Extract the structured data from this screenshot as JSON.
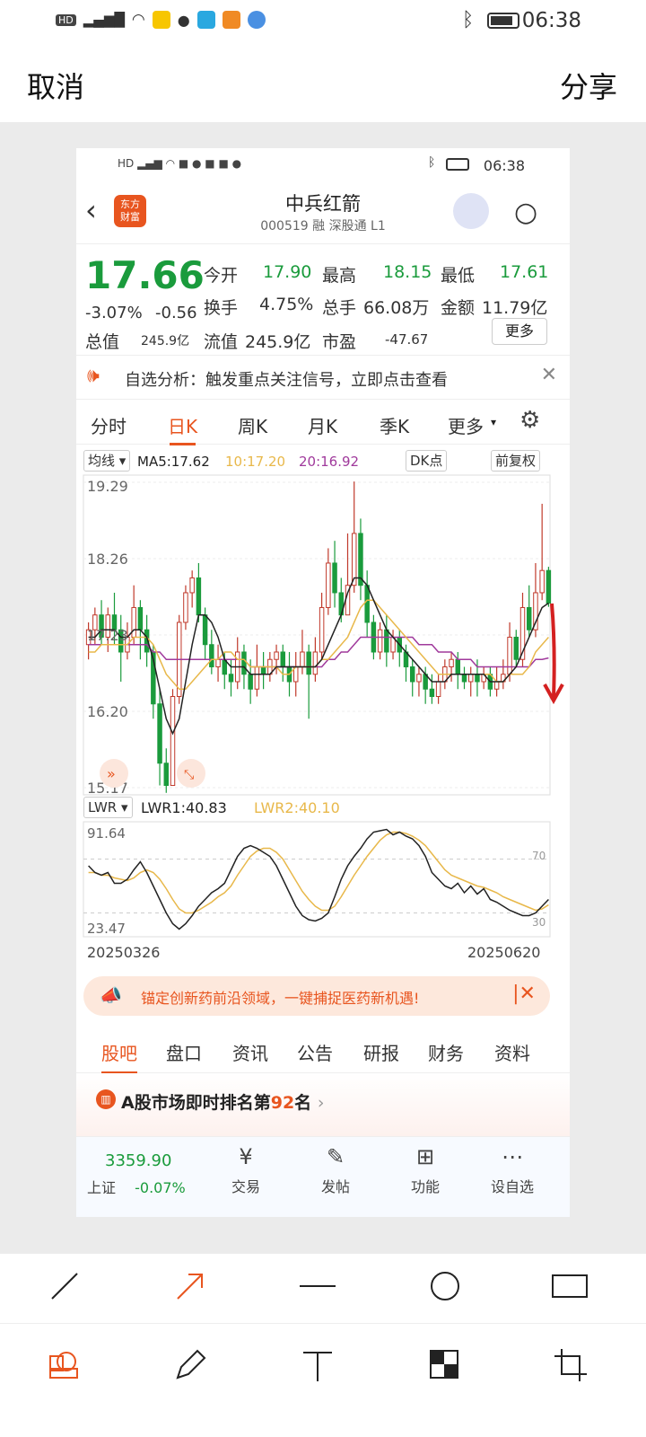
{
  "status": {
    "time": "06:38"
  },
  "header": {
    "cancel": "取消",
    "share": "分享"
  },
  "inner_status": {
    "time": "06:38"
  },
  "stock": {
    "logo_line1": "东方",
    "logo_line2": "财富",
    "name": "中兵红箭",
    "code_line": "000519 融 深股通 L1",
    "price": "17.66",
    "change_pct": "-3.07%",
    "change_abs": "-0.56",
    "open_label": "今开",
    "open": "17.90",
    "high_label": "最高",
    "high": "18.15",
    "low_label": "最低",
    "low": "17.61",
    "turnover_label": "换手",
    "turnover": "4.75%",
    "volume_label": "总手",
    "volume": "66.08万",
    "amount_label": "金额",
    "amount": "11.79亿",
    "mktcap_label": "总值",
    "mktcap": "245.9亿",
    "float_label": "流值",
    "float": "245.9亿",
    "pe_label": "市盈",
    "pe": "-47.67",
    "more": "更多"
  },
  "notice": {
    "text": "自选分析：触发重点关注信号，立即点击查看"
  },
  "ktabs": [
    "分时",
    "日K",
    "周K",
    "月K",
    "季K",
    "更多"
  ],
  "ma": {
    "sel": "均线",
    "ma5": "MA5:17.62",
    "ma10": "10:17.20",
    "ma20": "20:16.92",
    "dk": "DK点",
    "adj": "前复权"
  },
  "chart_data": {
    "type": "candlestick",
    "ylim": [
      15.17,
      19.29
    ],
    "yticks": [
      "19.29",
      "18.26",
      "17.23",
      "16.20",
      "15.17"
    ],
    "colors": {
      "up": "#c0392b",
      "down": "#1a9b3c",
      "ma5": "#222222",
      "ma10": "#e8b84a",
      "ma20": "#a03a9c"
    },
    "candles": [
      [
        17.1,
        17.3,
        17.4,
        16.9
      ],
      [
        17.3,
        17.5,
        17.6,
        17.1
      ],
      [
        17.5,
        17.2,
        17.7,
        17.1
      ],
      [
        17.2,
        17.5,
        17.6,
        17.0
      ],
      [
        17.5,
        17.3,
        17.8,
        17.1
      ],
      [
        17.3,
        17.0,
        17.5,
        16.6
      ],
      [
        17.0,
        17.2,
        17.4,
        16.9
      ],
      [
        17.2,
        17.6,
        17.9,
        17.1
      ],
      [
        17.6,
        17.3,
        17.7,
        16.9
      ],
      [
        17.3,
        17.0,
        17.5,
        16.8
      ],
      [
        17.0,
        16.3,
        17.1,
        16.1
      ],
      [
        16.3,
        15.5,
        16.5,
        15.2
      ],
      [
        15.5,
        15.2,
        15.7,
        15.1
      ],
      [
        15.2,
        16.4,
        16.5,
        15.2
      ],
      [
        16.4,
        17.4,
        17.5,
        16.3
      ],
      [
        17.4,
        17.8,
        17.9,
        17.3
      ],
      [
        17.8,
        18.0,
        18.1,
        17.6
      ],
      [
        18.0,
        17.5,
        18.2,
        17.4
      ],
      [
        17.5,
        17.1,
        17.6,
        16.9
      ],
      [
        17.1,
        16.8,
        17.3,
        16.7
      ],
      [
        16.8,
        16.9,
        17.1,
        16.6
      ],
      [
        16.9,
        16.7,
        17.0,
        16.5
      ],
      [
        16.7,
        16.6,
        16.9,
        16.4
      ],
      [
        16.6,
        17.0,
        17.2,
        16.5
      ],
      [
        17.0,
        16.7,
        17.1,
        16.5
      ],
      [
        16.7,
        16.5,
        16.9,
        16.3
      ],
      [
        16.5,
        16.8,
        17.1,
        16.4
      ],
      [
        16.8,
        16.7,
        17.0,
        16.5
      ],
      [
        16.7,
        16.9,
        17.0,
        16.6
      ],
      [
        16.9,
        17.0,
        17.1,
        16.7
      ],
      [
        17.0,
        16.8,
        17.1,
        16.6
      ],
      [
        16.8,
        16.6,
        17.0,
        16.4
      ],
      [
        16.6,
        16.8,
        17.0,
        16.4
      ],
      [
        16.8,
        17.0,
        17.3,
        16.7
      ],
      [
        17.0,
        16.7,
        17.1,
        16.1
      ],
      [
        16.7,
        17.0,
        17.2,
        16.6
      ],
      [
        17.0,
        17.6,
        17.8,
        16.9
      ],
      [
        17.6,
        18.2,
        18.4,
        17.5
      ],
      [
        18.2,
        17.8,
        18.5,
        17.6
      ],
      [
        17.8,
        17.5,
        18.0,
        17.4
      ],
      [
        17.5,
        17.9,
        18.6,
        17.5
      ],
      [
        17.9,
        18.6,
        19.3,
        17.8
      ],
      [
        18.6,
        17.9,
        18.8,
        17.7
      ],
      [
        17.9,
        17.4,
        18.1,
        17.2
      ],
      [
        17.4,
        17.0,
        17.5,
        16.9
      ],
      [
        17.0,
        17.3,
        17.4,
        16.9
      ],
      [
        17.3,
        17.0,
        17.5,
        16.8
      ],
      [
        17.0,
        17.2,
        17.3,
        16.9
      ],
      [
        17.2,
        17.0,
        17.3,
        16.8
      ],
      [
        17.0,
        16.8,
        17.1,
        16.6
      ],
      [
        16.8,
        16.6,
        16.9,
        16.4
      ],
      [
        16.6,
        16.7,
        16.8,
        16.4
      ],
      [
        16.7,
        16.5,
        16.8,
        16.3
      ],
      [
        16.5,
        16.4,
        16.7,
        16.3
      ],
      [
        16.4,
        16.6,
        16.7,
        16.3
      ],
      [
        16.6,
        16.8,
        16.9,
        16.5
      ],
      [
        16.8,
        16.9,
        17.0,
        16.6
      ],
      [
        16.9,
        16.7,
        17.0,
        16.5
      ],
      [
        16.7,
        16.6,
        16.8,
        16.5
      ],
      [
        16.6,
        16.7,
        16.8,
        16.4
      ],
      [
        16.7,
        16.6,
        16.9,
        16.4
      ],
      [
        16.6,
        16.7,
        16.8,
        16.5
      ],
      [
        16.7,
        16.5,
        16.8,
        16.4
      ],
      [
        16.5,
        16.6,
        16.8,
        16.4
      ],
      [
        16.6,
        16.7,
        16.9,
        16.5
      ],
      [
        16.7,
        17.2,
        17.4,
        16.6
      ],
      [
        17.2,
        16.9,
        17.3,
        16.8
      ],
      [
        16.9,
        17.6,
        17.8,
        16.8
      ],
      [
        17.6,
        17.3,
        17.9,
        17.2
      ],
      [
        17.3,
        17.8,
        18.2,
        17.2
      ],
      [
        17.8,
        18.1,
        19.0,
        17.7
      ],
      [
        18.1,
        17.66,
        18.15,
        17.61
      ]
    ],
    "ma5": [
      17.2,
      17.2,
      17.3,
      17.3,
      17.3,
      17.2,
      17.2,
      17.3,
      17.3,
      17.2,
      16.9,
      16.5,
      16.1,
      15.9,
      16.1,
      16.6,
      17.1,
      17.5,
      17.5,
      17.4,
      17.2,
      16.9,
      16.8,
      16.8,
      16.8,
      16.7,
      16.7,
      16.7,
      16.7,
      16.8,
      16.8,
      16.8,
      16.8,
      16.8,
      16.8,
      16.8,
      16.9,
      17.1,
      17.3,
      17.5,
      17.8,
      18.0,
      18.0,
      17.9,
      17.7,
      17.5,
      17.3,
      17.2,
      17.1,
      17.0,
      16.9,
      16.8,
      16.7,
      16.6,
      16.6,
      16.6,
      16.7,
      16.7,
      16.7,
      16.7,
      16.7,
      16.7,
      16.6,
      16.6,
      16.6,
      16.7,
      16.8,
      17.0,
      17.2,
      17.4,
      17.6,
      17.66
    ],
    "ma10": [
      17.0,
      17.0,
      17.1,
      17.1,
      17.1,
      17.1,
      17.1,
      17.2,
      17.2,
      17.2,
      17.1,
      16.9,
      16.7,
      16.6,
      16.5,
      16.5,
      16.6,
      16.7,
      16.8,
      16.9,
      16.9,
      17.0,
      17.0,
      16.9,
      16.9,
      16.8,
      16.8,
      16.8,
      16.8,
      16.8,
      16.7,
      16.7,
      16.8,
      16.8,
      16.8,
      16.8,
      16.9,
      16.9,
      17.0,
      17.1,
      17.2,
      17.4,
      17.6,
      17.7,
      17.7,
      17.6,
      17.5,
      17.4,
      17.3,
      17.2,
      17.1,
      17.0,
      16.9,
      16.8,
      16.7,
      16.7,
      16.7,
      16.7,
      16.7,
      16.7,
      16.7,
      16.7,
      16.7,
      16.6,
      16.6,
      16.7,
      16.7,
      16.7,
      16.8,
      17.0,
      17.1,
      17.2
    ],
    "ma20": [
      17.1,
      17.1,
      17.1,
      17.1,
      17.1,
      17.1,
      17.1,
      17.1,
      17.1,
      17.1,
      17.0,
      17.0,
      16.9,
      16.9,
      16.9,
      16.9,
      16.9,
      16.9,
      16.9,
      16.9,
      16.9,
      16.9,
      16.9,
      16.9,
      16.9,
      16.8,
      16.8,
      16.8,
      16.8,
      16.8,
      16.8,
      16.8,
      16.8,
      16.8,
      16.8,
      16.8,
      16.8,
      16.9,
      16.9,
      17.0,
      17.0,
      17.1,
      17.2,
      17.2,
      17.2,
      17.2,
      17.2,
      17.2,
      17.2,
      17.2,
      17.2,
      17.1,
      17.1,
      17.1,
      17.0,
      17.0,
      17.0,
      16.9,
      16.9,
      16.9,
      16.8,
      16.8,
      16.8,
      16.8,
      16.8,
      16.8,
      16.8,
      16.8,
      16.8,
      16.9,
      16.9,
      16.92
    ]
  },
  "lwr": {
    "sel": "LWR",
    "lwr1": "LWR1:40.83",
    "lwr2": "LWR2:40.10",
    "ytop": "91.64",
    "ybottom": "23.47",
    "ref70": "70",
    "ref30": "30",
    "ylim": [
      15,
      95
    ],
    "line1": [
      65,
      60,
      58,
      60,
      52,
      52,
      55,
      62,
      68,
      60,
      50,
      40,
      30,
      22,
      18,
      22,
      28,
      35,
      40,
      45,
      48,
      52,
      62,
      72,
      78,
      80,
      78,
      75,
      72,
      65,
      55,
      45,
      35,
      28,
      25,
      24,
      26,
      30,
      42,
      55,
      65,
      72,
      78,
      85,
      90,
      91,
      92,
      88,
      90,
      87,
      85,
      80,
      72,
      60,
      55,
      50,
      48,
      52,
      45,
      50,
      44,
      48,
      40,
      38,
      35,
      32,
      30,
      28,
      28,
      30,
      35,
      40
    ],
    "line2": [
      60,
      60,
      58,
      58,
      56,
      55,
      54,
      56,
      60,
      62,
      60,
      55,
      48,
      40,
      33,
      30,
      30,
      32,
      35,
      38,
      42,
      45,
      50,
      58,
      65,
      72,
      76,
      78,
      78,
      75,
      70,
      62,
      54,
      46,
      40,
      35,
      32,
      32,
      35,
      42,
      50,
      58,
      65,
      72,
      78,
      84,
      88,
      90,
      90,
      89,
      87,
      84,
      80,
      74,
      68,
      62,
      58,
      56,
      54,
      52,
      50,
      49,
      47,
      45,
      42,
      40,
      38,
      36,
      34,
      32,
      33,
      36
    ]
  },
  "dates": {
    "start": "20250326",
    "end": "20250620"
  },
  "ad": {
    "text": "锚定创新药前沿领域，一键捕捉医药新机遇!"
  },
  "btabs": [
    "股吧",
    "盘口",
    "资讯",
    "公告",
    "研报",
    "财务",
    "资料"
  ],
  "rank": {
    "prefix": "A股市场即时排名第",
    "num": "92",
    "suffix": "名"
  },
  "bnav": {
    "index_value": "3359.90",
    "index_name": "上证",
    "index_change": "-0.07%",
    "trade": "交易",
    "post": "发帖",
    "func": "功能",
    "watch": "设自选"
  }
}
